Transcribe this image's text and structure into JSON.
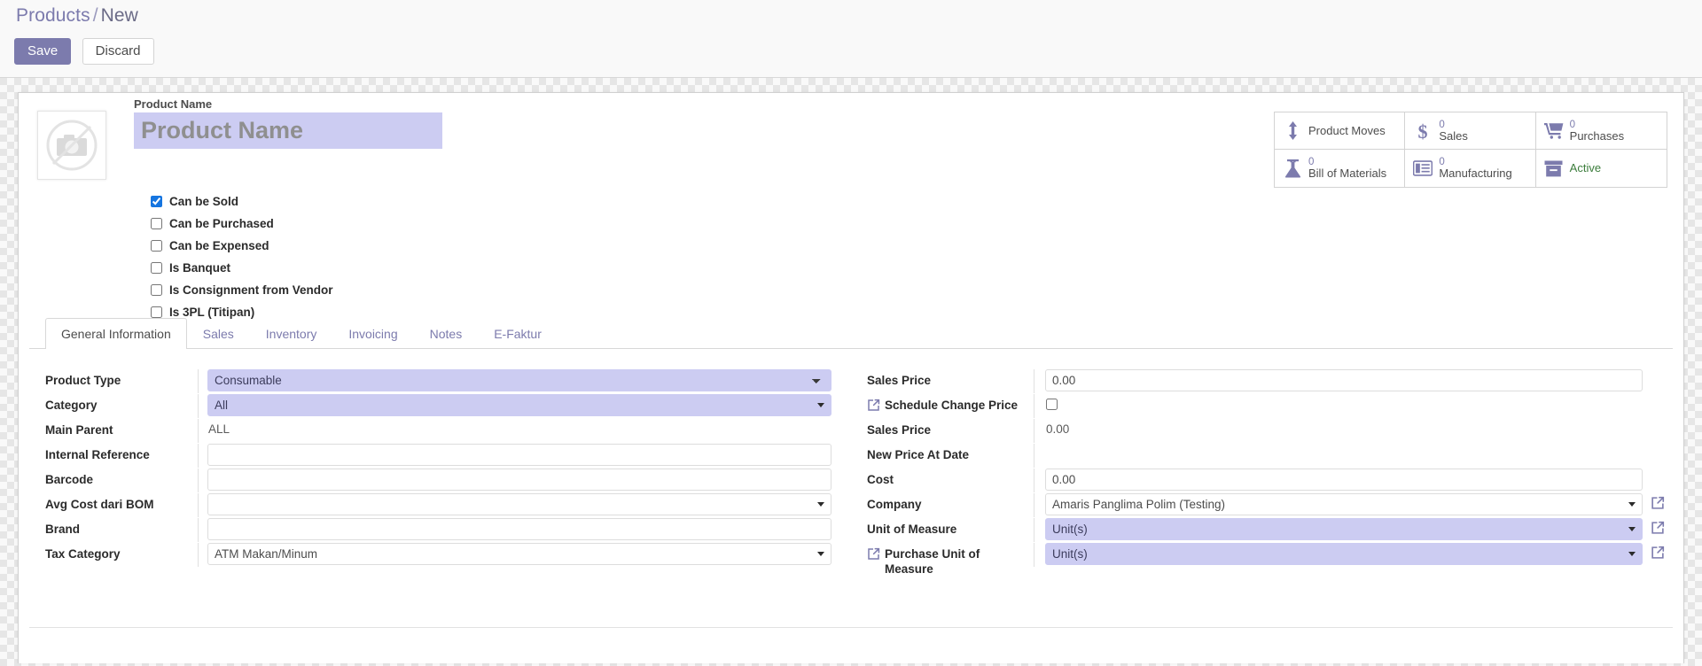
{
  "breadcrumb": {
    "root": "Products",
    "separator": "/",
    "current": "New"
  },
  "toolbar": {
    "save_label": "Save",
    "discard_label": "Discard"
  },
  "title_field": {
    "caption": "Product Name",
    "value": "",
    "placeholder": "Product Name"
  },
  "checkboxes": [
    {
      "label": "Can be Sold",
      "checked": true
    },
    {
      "label": "Can be Purchased",
      "checked": false
    },
    {
      "label": "Can be Expensed",
      "checked": false
    },
    {
      "label": "Is Banquet",
      "checked": false
    },
    {
      "label": "Is Consignment from Vendor",
      "checked": false
    },
    {
      "label": "Is 3PL (Titipan)",
      "checked": false
    }
  ],
  "stat_buttons": [
    {
      "icon": "arrows-vertical-icon",
      "value": "",
      "label": "Product Moves",
      "label_color": "#4c4c4c"
    },
    {
      "icon": "dollar-icon",
      "value": "0",
      "label": "Sales",
      "label_color": "#4c4c4c"
    },
    {
      "icon": "shopping-cart-icon",
      "value": "0",
      "label": "Purchases",
      "label_color": "#4c4c4c"
    },
    {
      "icon": "flask-icon",
      "value": "0",
      "label": "Bill of Materials",
      "label_color": "#4c4c4c"
    },
    {
      "icon": "list-card-icon",
      "value": "0",
      "label": "Manufacturing",
      "label_color": "#4c4c4c"
    },
    {
      "icon": "archive-box-icon",
      "value": "",
      "label": "Active",
      "label_color": "#3c7d3c"
    }
  ],
  "tabs": [
    {
      "label": "General Information",
      "active": true
    },
    {
      "label": "Sales",
      "active": false
    },
    {
      "label": "Inventory",
      "active": false
    },
    {
      "label": "Invoicing",
      "active": false
    },
    {
      "label": "Notes",
      "active": false
    },
    {
      "label": "E-Faktur",
      "active": false
    }
  ],
  "left_fields": [
    {
      "label": "Product Type",
      "type": "select",
      "value": "Consumable",
      "required": true
    },
    {
      "label": "Category",
      "type": "many2one",
      "value": "All",
      "required": true
    },
    {
      "label": "Main Parent",
      "type": "readonly",
      "value": "ALL"
    },
    {
      "label": "Internal Reference",
      "type": "input",
      "value": ""
    },
    {
      "label": "Barcode",
      "type": "input",
      "value": ""
    },
    {
      "label": "Avg Cost dari BOM",
      "type": "many2one",
      "value": ""
    },
    {
      "label": "Brand",
      "type": "input",
      "value": ""
    },
    {
      "label": "Tax Category",
      "type": "many2one",
      "value": "ATM Makan/Minum"
    }
  ],
  "right_fields": [
    {
      "label": "Sales Price",
      "type": "input",
      "value": "0.00",
      "ext": false,
      "link": false
    },
    {
      "label": "Schedule Change Price",
      "type": "checkbox",
      "value": "",
      "checked": false,
      "ext": true,
      "link": false
    },
    {
      "label": "Sales Price",
      "type": "readonly",
      "value": "0.00",
      "ext": false,
      "link": false
    },
    {
      "label": "New Price At Date",
      "type": "blank",
      "value": "",
      "ext": false,
      "link": false
    },
    {
      "label": "Cost",
      "type": "input",
      "value": "0.00",
      "ext": false,
      "link": false
    },
    {
      "label": "Company",
      "type": "many2one",
      "value": "Amaris Panglima Polim (Testing)",
      "required": false,
      "ext": false,
      "link": true
    },
    {
      "label": "Unit of Measure",
      "type": "many2one",
      "value": "Unit(s)",
      "required": true,
      "ext": false,
      "link": true
    },
    {
      "label": "Purchase Unit of Measure",
      "type": "many2one",
      "value": "Unit(s)",
      "required": true,
      "ext": true,
      "link": true
    }
  ],
  "colors": {
    "accent": "#7c7bad",
    "required_field_bg": "#ccccf2",
    "checkbox_checked": "#1675e0",
    "active_green": "#3c7d3c",
    "page_bg": "#f9f9f9"
  },
  "icons": {
    "image_placeholder": "no-camera-icon",
    "external_link": "external-link-icon"
  }
}
